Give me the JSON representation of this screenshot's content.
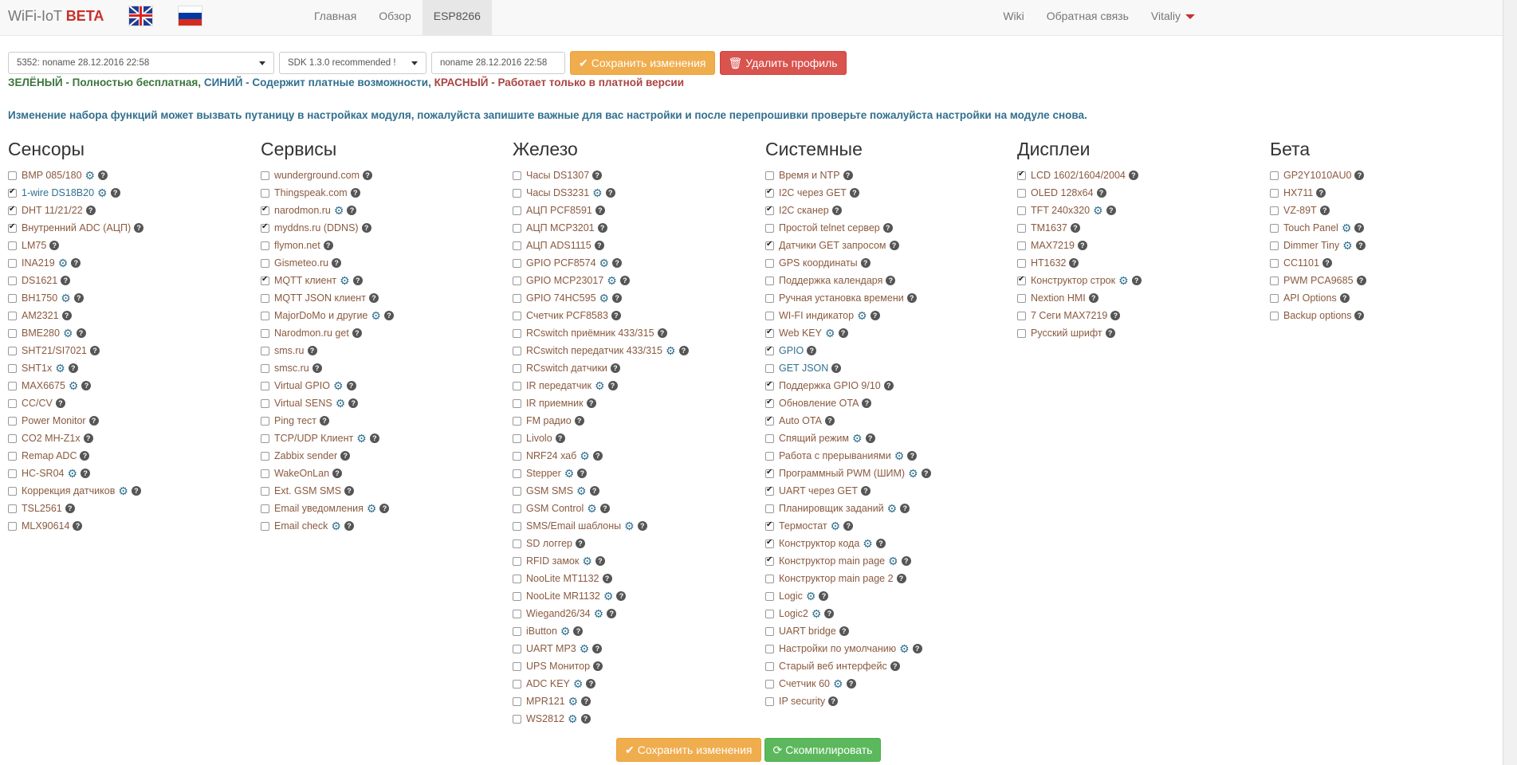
{
  "brand": {
    "name": "WiFi-IoT",
    "tag": "BETA"
  },
  "nav": {
    "left": [
      "Главная",
      "Обзор",
      "ESP8266"
    ],
    "right": [
      "Wiki",
      "Обратная связь",
      "Vitaliy"
    ]
  },
  "toolbar": {
    "profile": "5352: noname 28.12.2016 22:58",
    "sdk": "SDK 1.3.0 recommended !",
    "name": "noname 28.12.2016 22:58",
    "save": "Сохранить изменения",
    "delete": "Удалить профиль"
  },
  "legend": {
    "green": "ЗЕЛЁНЫЙ - Полностью бесплатная,",
    "blue": "СИНИЙ - Содержит платные возможности,",
    "red": "КРАСНЫЙ - Работает только в платной версии"
  },
  "warning": "Изменение набора функций может вызвать путаницу в настройках модуля, пожалуйста запишите важные для вас настройки и после перепрошивки проверьте пожалуйста настройки на модуле снова.",
  "columns": [
    {
      "title": "Сенсоры",
      "items": [
        {
          "label": "BMP 085/180",
          "checked": false,
          "gear": true,
          "kind": "free"
        },
        {
          "label": "1-wire DS18B20",
          "checked": true,
          "gear": true,
          "kind": "blue"
        },
        {
          "label": "DHT 11/21/22",
          "checked": true,
          "gear": false,
          "kind": "free"
        },
        {
          "label": "Внутренний ADC (АЦП)",
          "checked": true,
          "gear": false,
          "kind": "free"
        },
        {
          "label": "LM75",
          "checked": false,
          "gear": false,
          "kind": "free"
        },
        {
          "label": "INA219",
          "checked": false,
          "gear": true,
          "kind": "free"
        },
        {
          "label": "DS1621",
          "checked": false,
          "gear": false,
          "kind": "free"
        },
        {
          "label": "BH1750",
          "checked": false,
          "gear": true,
          "kind": "free"
        },
        {
          "label": "AM2321",
          "checked": false,
          "gear": false,
          "kind": "free"
        },
        {
          "label": "BME280",
          "checked": false,
          "gear": true,
          "kind": "free"
        },
        {
          "label": "SHT21/SI7021",
          "checked": false,
          "gear": false,
          "kind": "free"
        },
        {
          "label": "SHT1x",
          "checked": false,
          "gear": true,
          "kind": "free"
        },
        {
          "label": "MAX6675",
          "checked": false,
          "gear": true,
          "kind": "free"
        },
        {
          "label": "CC/CV",
          "checked": false,
          "gear": false,
          "kind": "free"
        },
        {
          "label": "Power Monitor",
          "checked": false,
          "gear": false,
          "kind": "free"
        },
        {
          "label": "CO2 MH-Z1x",
          "checked": false,
          "gear": false,
          "kind": "free"
        },
        {
          "label": "Remap ADC",
          "checked": false,
          "gear": false,
          "kind": "free"
        },
        {
          "label": "HC-SR04",
          "checked": false,
          "gear": true,
          "kind": "free"
        },
        {
          "label": "Коррекция датчиков",
          "checked": false,
          "gear": true,
          "kind": "free"
        },
        {
          "label": "TSL2561",
          "checked": false,
          "gear": false,
          "kind": "free"
        },
        {
          "label": "MLX90614",
          "checked": false,
          "gear": false,
          "kind": "free"
        }
      ]
    },
    {
      "title": "Сервисы",
      "items": [
        {
          "label": "wunderground.com",
          "checked": false,
          "gear": false,
          "kind": "free"
        },
        {
          "label": "Thingspeak.com",
          "checked": false,
          "gear": false,
          "kind": "free"
        },
        {
          "label": "narodmon.ru",
          "checked": true,
          "gear": true,
          "kind": "free"
        },
        {
          "label": "myddns.ru (DDNS)",
          "checked": true,
          "gear": false,
          "kind": "free"
        },
        {
          "label": "flymon.net",
          "checked": false,
          "gear": false,
          "kind": "free"
        },
        {
          "label": "Gismeteo.ru",
          "checked": false,
          "gear": false,
          "kind": "free"
        },
        {
          "label": "MQTT клиент",
          "checked": true,
          "gear": true,
          "kind": "free"
        },
        {
          "label": "MQTT JSON клиент",
          "checked": false,
          "gear": false,
          "kind": "free"
        },
        {
          "label": "MajorDoMo и другие",
          "checked": false,
          "gear": true,
          "kind": "free"
        },
        {
          "label": "Narodmon.ru get",
          "checked": false,
          "gear": false,
          "kind": "free"
        },
        {
          "label": "sms.ru",
          "checked": false,
          "gear": false,
          "kind": "free"
        },
        {
          "label": "smsc.ru",
          "checked": false,
          "gear": false,
          "kind": "free"
        },
        {
          "label": "Virtual GPIO",
          "checked": false,
          "gear": true,
          "kind": "free"
        },
        {
          "label": "Virtual SENS",
          "checked": false,
          "gear": true,
          "kind": "free"
        },
        {
          "label": "Ping тест",
          "checked": false,
          "gear": false,
          "kind": "free"
        },
        {
          "label": "TCP/UDP Клиент",
          "checked": false,
          "gear": true,
          "kind": "free"
        },
        {
          "label": "Zabbix sender",
          "checked": false,
          "gear": false,
          "kind": "free"
        },
        {
          "label": "WakeOnLan",
          "checked": false,
          "gear": false,
          "kind": "free"
        },
        {
          "label": "Ext. GSM SMS",
          "checked": false,
          "gear": false,
          "kind": "free"
        },
        {
          "label": "Email уведомления",
          "checked": false,
          "gear": true,
          "kind": "free"
        },
        {
          "label": "Email check",
          "checked": false,
          "gear": true,
          "kind": "free"
        }
      ]
    },
    {
      "title": "Железо",
      "items": [
        {
          "label": "Часы DS1307",
          "checked": false,
          "gear": false,
          "kind": "free"
        },
        {
          "label": "Часы DS3231",
          "checked": false,
          "gear": true,
          "kind": "free"
        },
        {
          "label": "АЦП PCF8591",
          "checked": false,
          "gear": false,
          "kind": "free"
        },
        {
          "label": "АЦП MCP3201",
          "checked": false,
          "gear": false,
          "kind": "free"
        },
        {
          "label": "АЦП ADS1115",
          "checked": false,
          "gear": false,
          "kind": "free"
        },
        {
          "label": "GPIO PCF8574",
          "checked": false,
          "gear": true,
          "kind": "free"
        },
        {
          "label": "GPIO MCP23017",
          "checked": false,
          "gear": true,
          "kind": "free"
        },
        {
          "label": "GPIO 74HC595",
          "checked": false,
          "gear": true,
          "kind": "free"
        },
        {
          "label": "Счетчик PCF8583",
          "checked": false,
          "gear": false,
          "kind": "free"
        },
        {
          "label": "RCswitch приёмник 433/315",
          "checked": false,
          "gear": false,
          "kind": "free"
        },
        {
          "label": "RCswitch передатчик 433/315",
          "checked": false,
          "gear": true,
          "kind": "free"
        },
        {
          "label": "RCswitch датчики",
          "checked": false,
          "gear": false,
          "kind": "free"
        },
        {
          "label": "IR передатчик",
          "checked": false,
          "gear": true,
          "kind": "free"
        },
        {
          "label": "IR приемник",
          "checked": false,
          "gear": false,
          "kind": "free"
        },
        {
          "label": "FM радио",
          "checked": false,
          "gear": false,
          "kind": "free"
        },
        {
          "label": "Livolo",
          "checked": false,
          "gear": false,
          "kind": "free"
        },
        {
          "label": "NRF24 хаб",
          "checked": false,
          "gear": true,
          "kind": "free"
        },
        {
          "label": "Stepper",
          "checked": false,
          "gear": true,
          "kind": "free"
        },
        {
          "label": "GSM SMS",
          "checked": false,
          "gear": true,
          "kind": "free"
        },
        {
          "label": "GSM Control",
          "checked": false,
          "gear": true,
          "kind": "free"
        },
        {
          "label": "SMS/Email шаблоны",
          "checked": false,
          "gear": true,
          "kind": "free"
        },
        {
          "label": "SD логгер",
          "checked": false,
          "gear": false,
          "kind": "free"
        },
        {
          "label": "RFID замок",
          "checked": false,
          "gear": true,
          "kind": "free"
        },
        {
          "label": "NooLite MT1132",
          "checked": false,
          "gear": false,
          "kind": "free"
        },
        {
          "label": "NooLite MR1132",
          "checked": false,
          "gear": true,
          "kind": "free"
        },
        {
          "label": "Wiegand26/34",
          "checked": false,
          "gear": true,
          "kind": "free"
        },
        {
          "label": "iButton",
          "checked": false,
          "gear": true,
          "kind": "free"
        },
        {
          "label": "UART MP3",
          "checked": false,
          "gear": true,
          "kind": "free"
        },
        {
          "label": "UPS Монитор",
          "checked": false,
          "gear": false,
          "kind": "free"
        },
        {
          "label": "ADC KEY",
          "checked": false,
          "gear": true,
          "kind": "free"
        },
        {
          "label": "MPR121",
          "checked": false,
          "gear": true,
          "kind": "free"
        },
        {
          "label": "WS2812",
          "checked": false,
          "gear": true,
          "kind": "free"
        }
      ]
    },
    {
      "title": "Системные",
      "items": [
        {
          "label": "Время и NTP",
          "checked": false,
          "gear": false,
          "kind": "free"
        },
        {
          "label": "I2C через GET",
          "checked": true,
          "gear": false,
          "kind": "free"
        },
        {
          "label": "I2C сканер",
          "checked": true,
          "gear": false,
          "kind": "free"
        },
        {
          "label": "Простой telnet сервер",
          "checked": false,
          "gear": false,
          "kind": "free"
        },
        {
          "label": "Датчики GET запросом",
          "checked": true,
          "gear": false,
          "kind": "free"
        },
        {
          "label": "GPS координаты",
          "checked": false,
          "gear": false,
          "kind": "free"
        },
        {
          "label": "Поддержка календаря",
          "checked": false,
          "gear": false,
          "kind": "free"
        },
        {
          "label": "Ручная установка времени",
          "checked": false,
          "gear": false,
          "kind": "free"
        },
        {
          "label": "WI-FI индикатор",
          "checked": false,
          "gear": true,
          "kind": "free"
        },
        {
          "label": "Web KEY",
          "checked": true,
          "gear": true,
          "kind": "free"
        },
        {
          "label": "GPIO",
          "checked": true,
          "gear": false,
          "kind": "blue"
        },
        {
          "label": "GET JSON",
          "checked": false,
          "gear": false,
          "kind": "blue"
        },
        {
          "label": "Поддержка GPIO 9/10",
          "checked": true,
          "gear": false,
          "kind": "free"
        },
        {
          "label": "Обновление OTA",
          "checked": true,
          "gear": false,
          "kind": "free"
        },
        {
          "label": "Auto OTA",
          "checked": true,
          "gear": false,
          "kind": "free"
        },
        {
          "label": "Спящий режим",
          "checked": false,
          "gear": true,
          "kind": "free"
        },
        {
          "label": "Работа с прерываниями",
          "checked": false,
          "gear": true,
          "kind": "free"
        },
        {
          "label": "Программный PWM (ШИМ)",
          "checked": true,
          "gear": true,
          "kind": "free"
        },
        {
          "label": "UART через GET",
          "checked": true,
          "gear": false,
          "kind": "free"
        },
        {
          "label": "Планировщик заданий",
          "checked": false,
          "gear": true,
          "kind": "free"
        },
        {
          "label": "Термостат",
          "checked": true,
          "gear": true,
          "kind": "free"
        },
        {
          "label": "Конструктор кода",
          "checked": true,
          "gear": true,
          "kind": "free"
        },
        {
          "label": "Конструктор main page",
          "checked": true,
          "gear": true,
          "kind": "free"
        },
        {
          "label": "Конструктор main page 2",
          "checked": false,
          "gear": false,
          "kind": "free"
        },
        {
          "label": "Logic",
          "checked": false,
          "gear": true,
          "kind": "free"
        },
        {
          "label": "Logic2",
          "checked": false,
          "gear": true,
          "kind": "free"
        },
        {
          "label": "UART bridge",
          "checked": false,
          "gear": false,
          "kind": "free"
        },
        {
          "label": "Настройки по умолчанию",
          "checked": false,
          "gear": true,
          "kind": "free"
        },
        {
          "label": "Старый веб интерфейс",
          "checked": false,
          "gear": false,
          "kind": "free"
        },
        {
          "label": "Счетчик 60",
          "checked": false,
          "gear": true,
          "kind": "free"
        },
        {
          "label": "IP security",
          "checked": false,
          "gear": false,
          "kind": "free"
        }
      ]
    },
    {
      "title": "Дисплеи",
      "items": [
        {
          "label": "LCD 1602/1604/2004",
          "checked": true,
          "gear": false,
          "kind": "free"
        },
        {
          "label": "OLED 128x64",
          "checked": false,
          "gear": false,
          "kind": "free"
        },
        {
          "label": "TFT 240x320",
          "checked": false,
          "gear": true,
          "kind": "free"
        },
        {
          "label": "TM1637",
          "checked": false,
          "gear": false,
          "kind": "free"
        },
        {
          "label": "MAX7219",
          "checked": false,
          "gear": false,
          "kind": "free"
        },
        {
          "label": "HT1632",
          "checked": false,
          "gear": false,
          "kind": "free"
        },
        {
          "label": "Конструктор строк",
          "checked": true,
          "gear": true,
          "kind": "free"
        },
        {
          "label": "Nextion HMI",
          "checked": false,
          "gear": false,
          "kind": "free"
        },
        {
          "label": "7 Сеги MAX7219",
          "checked": false,
          "gear": false,
          "kind": "free"
        },
        {
          "label": "Русский шрифт",
          "checked": false,
          "gear": false,
          "kind": "free"
        }
      ]
    },
    {
      "title": "Бета",
      "items": [
        {
          "label": "GP2Y1010AU0",
          "checked": false,
          "gear": false,
          "kind": "free"
        },
        {
          "label": "HX711",
          "checked": false,
          "gear": false,
          "kind": "free"
        },
        {
          "label": "VZ-89T",
          "checked": false,
          "gear": false,
          "kind": "free"
        },
        {
          "label": "Touch Panel",
          "checked": false,
          "gear": true,
          "kind": "free"
        },
        {
          "label": "Dimmer Tiny",
          "checked": false,
          "gear": true,
          "kind": "free"
        },
        {
          "label": "CC1101",
          "checked": false,
          "gear": false,
          "kind": "free"
        },
        {
          "label": "PWM PCA9685",
          "checked": false,
          "gear": false,
          "kind": "free"
        },
        {
          "label": "API Options",
          "checked": false,
          "gear": false,
          "kind": "free"
        },
        {
          "label": "Backup options",
          "checked": false,
          "gear": false,
          "kind": "free"
        }
      ]
    }
  ],
  "bottom": {
    "save": "Сохранить изменения",
    "compile": "Скомпилировать"
  },
  "icons": {
    "gear": "gear-icon",
    "help": "help-icon",
    "check": "check-icon",
    "trash": "trash-icon",
    "refresh": "refresh-icon"
  }
}
